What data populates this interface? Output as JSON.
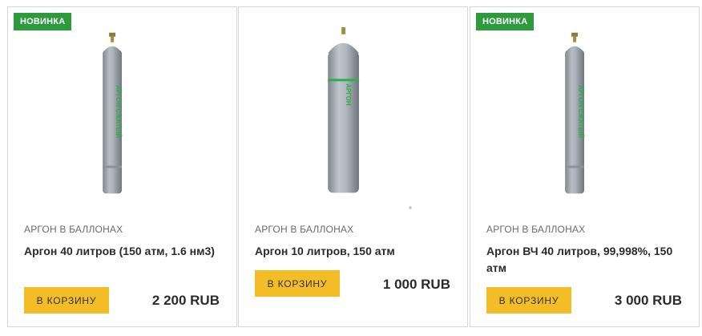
{
  "products": [
    {
      "badge": "НОВИНКА",
      "category": "АРГОН В БАЛЛОНАХ",
      "title": "Аргон 40 литров (150 атм, 1.6 нм3)",
      "button": "В КОРЗИНУ",
      "price": "2 200 RUB",
      "cylinder_label": "АРГОН СЖАТЫЙ"
    },
    {
      "category": "АРГОН В БАЛЛОНАХ",
      "title": "Аргон 10 литров, 150 атм",
      "button": "В КОРЗИНУ",
      "price": "1 000 RUB",
      "cylinder_label": "АРГОН"
    },
    {
      "badge": "НОВИНКА",
      "category": "АРГОН В БАЛЛОНАХ",
      "title": "Аргон ВЧ 40 литров, 99,998%, 150 атм",
      "button": "В КОРЗИНУ",
      "price": "3 000 RUB",
      "cylinder_label": "АРГОН СЖАТЫЙ"
    }
  ],
  "colors": {
    "badge_bg": "#2d9a3c",
    "button_bg": "#f2bd27",
    "cylinder": "#a3aab2",
    "label_green": "#2fae4a"
  }
}
